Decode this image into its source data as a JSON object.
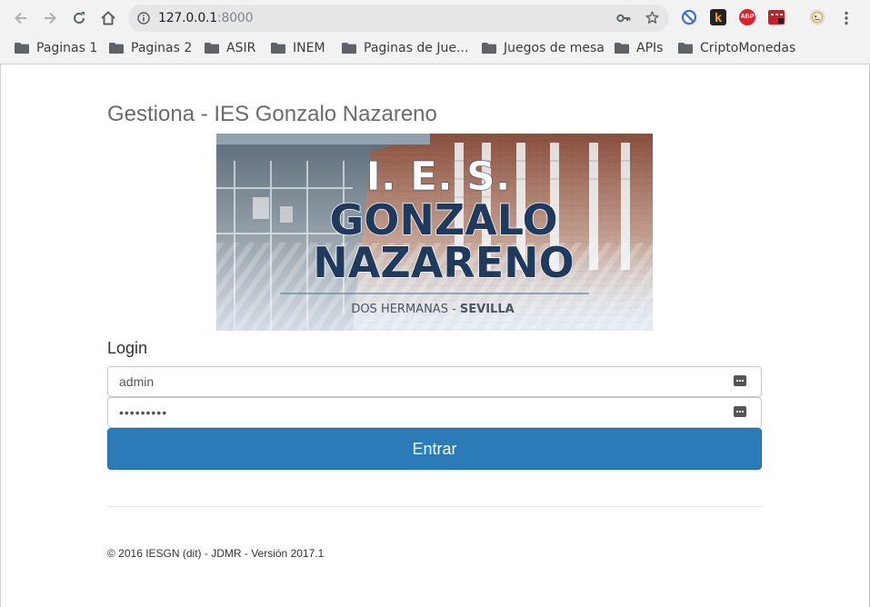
{
  "browser": {
    "url_host": "127.0.0.1",
    "url_port": ":8000",
    "bookmarks": [
      "Paginas 1",
      "Paginas 2",
      "ASIR",
      "INEM",
      "Paginas de Jue...",
      "Juegos de mesa",
      "APIs",
      "CriptoMonedas"
    ],
    "extensions": [
      {
        "name": "block-icon",
        "color": "#3b6fd8"
      },
      {
        "name": "k-extension-icon",
        "label": "k",
        "color": "#f6a623"
      },
      {
        "name": "adblock-icon",
        "label": "ABP",
        "color": "#d6262b"
      },
      {
        "name": "red-extension-icon",
        "color": "#c8202a"
      },
      {
        "name": "profile-avatar",
        "color": "#d8c9a0"
      }
    ]
  },
  "page": {
    "title": "Gestiona - IES Gonzalo Nazareno",
    "banner": {
      "line1": "I. E. S.",
      "line2": "GONZALO",
      "line3": "NAZARENO",
      "subtitle_a": "DOS HERMANAS - ",
      "subtitle_b": "SEVILLA"
    },
    "login_label": "Login",
    "username_value": "admin",
    "password_value": "•••••••••",
    "submit_label": "Entrar",
    "footer": "© 2016 IESGN (dit) - JDMR - Versión 2017.1"
  },
  "colors": {
    "primary": "#2b7bb9",
    "banner_text": "#1f3a5c"
  }
}
